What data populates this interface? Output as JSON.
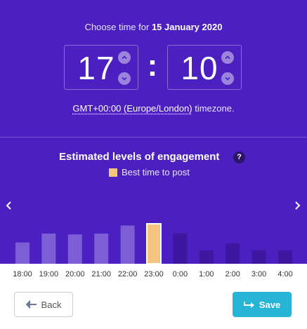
{
  "header": {
    "choose_prefix": "Choose time for",
    "date": "15 January 2020"
  },
  "time": {
    "hour": "17",
    "minute": "10",
    "separator": ":"
  },
  "timezone": {
    "link": "GMT+00:00 (Europe/London)",
    "suffix": " timezone."
  },
  "chart_header": {
    "title": "Estimated levels of engagement",
    "help": "?",
    "legend_label": "Best time to post"
  },
  "chart_data": {
    "type": "bar",
    "title": "Estimated levels of engagement",
    "categories": [
      "18:00",
      "19:00",
      "20:00",
      "21:00",
      "22:00",
      "23:00",
      "0:00",
      "1:00",
      "2:00",
      "3:00",
      "4:00"
    ],
    "values": [
      24,
      34,
      33,
      34,
      43,
      45,
      34,
      15,
      23,
      15,
      15
    ],
    "highlight_index": 5,
    "legend": [
      {
        "name": "Best time to post",
        "color": "#f3c57e"
      }
    ],
    "ylim": [
      0,
      60
    ],
    "colors": {
      "past_bar": "#7e5ed6",
      "best_bar": "#f3c57e",
      "future_bar": "#3c17a0"
    }
  },
  "footer": {
    "back_label": "Back",
    "save_label": "Save"
  },
  "colors": {
    "panel": "#4c1fc0",
    "save_button": "#26b5d6"
  }
}
